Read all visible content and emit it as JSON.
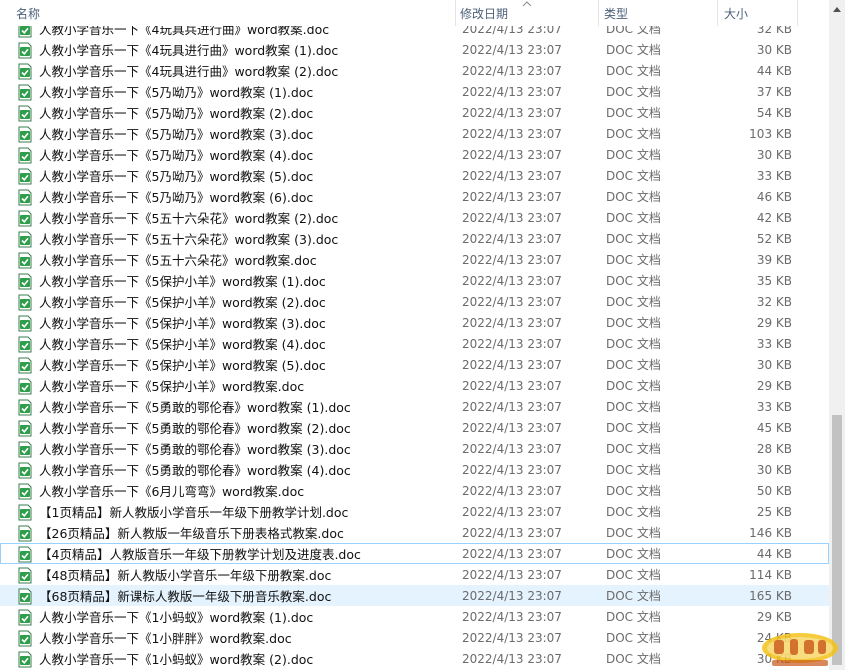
{
  "header": {
    "name": "名称",
    "date": "修改日期",
    "type": "类型",
    "size": "大小"
  },
  "rows": [
    {
      "name": "人教小学音乐一下《4玩具兵进行曲》word教案.doc",
      "date": "2022/4/13 23:07",
      "type": "DOC 文档",
      "size": "32 KB"
    },
    {
      "name": "人教小学音乐一下《4玩具进行曲》word教案 (1).doc",
      "date": "2022/4/13 23:07",
      "type": "DOC 文档",
      "size": "30 KB"
    },
    {
      "name": "人教小学音乐一下《4玩具进行曲》word教案 (2).doc",
      "date": "2022/4/13 23:07",
      "type": "DOC 文档",
      "size": "44 KB"
    },
    {
      "name": "人教小学音乐一下《5乃呦乃》word教案 (1).doc",
      "date": "2022/4/13 23:07",
      "type": "DOC 文档",
      "size": "37 KB"
    },
    {
      "name": "人教小学音乐一下《5乃呦乃》word教案 (2).doc",
      "date": "2022/4/13 23:07",
      "type": "DOC 文档",
      "size": "54 KB"
    },
    {
      "name": "人教小学音乐一下《5乃呦乃》word教案 (3).doc",
      "date": "2022/4/13 23:07",
      "type": "DOC 文档",
      "size": "103 KB"
    },
    {
      "name": "人教小学音乐一下《5乃呦乃》word教案 (4).doc",
      "date": "2022/4/13 23:07",
      "type": "DOC 文档",
      "size": "30 KB"
    },
    {
      "name": "人教小学音乐一下《5乃呦乃》word教案 (5).doc",
      "date": "2022/4/13 23:07",
      "type": "DOC 文档",
      "size": "33 KB"
    },
    {
      "name": "人教小学音乐一下《5乃呦乃》word教案 (6).doc",
      "date": "2022/4/13 23:07",
      "type": "DOC 文档",
      "size": "46 KB"
    },
    {
      "name": "人教小学音乐一下《5五十六朵花》word教案 (2).doc",
      "date": "2022/4/13 23:07",
      "type": "DOC 文档",
      "size": "42 KB"
    },
    {
      "name": "人教小学音乐一下《5五十六朵花》word教案 (3).doc",
      "date": "2022/4/13 23:07",
      "type": "DOC 文档",
      "size": "52 KB"
    },
    {
      "name": "人教小学音乐一下《5五十六朵花》word教案.doc",
      "date": "2022/4/13 23:07",
      "type": "DOC 文档",
      "size": "39 KB"
    },
    {
      "name": "人教小学音乐一下《5保护小羊》word教案 (1).doc",
      "date": "2022/4/13 23:07",
      "type": "DOC 文档",
      "size": "35 KB"
    },
    {
      "name": "人教小学音乐一下《5保护小羊》word教案 (2).doc",
      "date": "2022/4/13 23:07",
      "type": "DOC 文档",
      "size": "32 KB"
    },
    {
      "name": "人教小学音乐一下《5保护小羊》word教案 (3).doc",
      "date": "2022/4/13 23:07",
      "type": "DOC 文档",
      "size": "29 KB"
    },
    {
      "name": "人教小学音乐一下《5保护小羊》word教案 (4).doc",
      "date": "2022/4/13 23:07",
      "type": "DOC 文档",
      "size": "33 KB"
    },
    {
      "name": "人教小学音乐一下《5保护小羊》word教案 (5).doc",
      "date": "2022/4/13 23:07",
      "type": "DOC 文档",
      "size": "30 KB"
    },
    {
      "name": "人教小学音乐一下《5保护小羊》word教案.doc",
      "date": "2022/4/13 23:07",
      "type": "DOC 文档",
      "size": "29 KB"
    },
    {
      "name": "人教小学音乐一下《5勇敢的鄂伦春》word教案 (1).doc",
      "date": "2022/4/13 23:07",
      "type": "DOC 文档",
      "size": "33 KB"
    },
    {
      "name": "人教小学音乐一下《5勇敢的鄂伦春》word教案 (2).doc",
      "date": "2022/4/13 23:07",
      "type": "DOC 文档",
      "size": "45 KB"
    },
    {
      "name": "人教小学音乐一下《5勇敢的鄂伦春》word教案 (3).doc",
      "date": "2022/4/13 23:07",
      "type": "DOC 文档",
      "size": "28 KB"
    },
    {
      "name": "人教小学音乐一下《5勇敢的鄂伦春》word教案 (4).doc",
      "date": "2022/4/13 23:07",
      "type": "DOC 文档",
      "size": "30 KB"
    },
    {
      "name": "人教小学音乐一下《6月儿弯弯》word教案.doc",
      "date": "2022/4/13 23:07",
      "type": "DOC 文档",
      "size": "50 KB"
    },
    {
      "name": "【1页精品】新人教版小学音乐一年级下册教学计划.doc",
      "date": "2022/4/13 23:07",
      "type": "DOC 文档",
      "size": "25 KB"
    },
    {
      "name": "【26页精品】新人教版一年级音乐下册表格式教案.doc",
      "date": "2022/4/13 23:07",
      "type": "DOC 文档",
      "size": "146 KB"
    },
    {
      "name": "【4页精品】人教版音乐一年级下册教学计划及进度表.doc",
      "date": "2022/4/13 23:07",
      "type": "DOC 文档",
      "size": "44 KB",
      "focused": true
    },
    {
      "name": "【48页精品】新人教版小学音乐一年级下册教案.doc",
      "date": "2022/4/13 23:07",
      "type": "DOC 文档",
      "size": "114 KB"
    },
    {
      "name": "【68页精品】新课标人教版一年级下册音乐教案.doc",
      "date": "2022/4/13 23:07",
      "type": "DOC 文档",
      "size": "165 KB",
      "hover": true
    },
    {
      "name": "人教小学音乐一下《1小蚂蚁》word教案 (1).doc",
      "date": "2022/4/13 23:07",
      "type": "DOC 文档",
      "size": "29 KB"
    },
    {
      "name": "人教小学音乐一下《1小胖胖》word教案.doc",
      "date": "2022/4/13 23:07",
      "type": "DOC 文档",
      "size": "24 KB"
    },
    {
      "name": "人教小学音乐一下《1小蚂蚁》word教案 (2).doc",
      "date": "2022/4/13 23:07",
      "type": "DOC 文档",
      "size": "30 KB"
    }
  ],
  "icons": {
    "file": "doc-file-check-icon",
    "sort": "sort-chevron-up-icon"
  },
  "colors": {
    "hover": "#e5f3ff",
    "focus_border": "#99d1ff",
    "icon_green": "#2e9e4a",
    "header_text": "#4c607a"
  }
}
